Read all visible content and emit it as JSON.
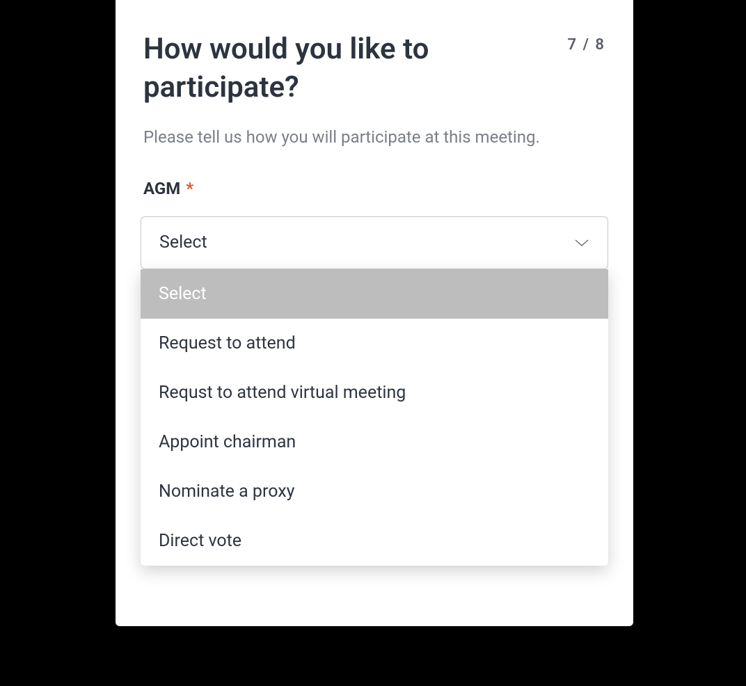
{
  "header": {
    "title": "How would you like to participate?",
    "step_counter": "7 / 8"
  },
  "subtitle": "Please tell us how you will participate at this meeting.",
  "field": {
    "label": "AGM",
    "required_marker": "*",
    "selected": "Select",
    "options": [
      {
        "label": "Select",
        "highlighted": true
      },
      {
        "label": "Request to attend",
        "highlighted": false
      },
      {
        "label": "Requst to attend virtual meeting",
        "highlighted": false
      },
      {
        "label": "Appoint chairman",
        "highlighted": false
      },
      {
        "label": "Nominate a proxy",
        "highlighted": false
      },
      {
        "label": "Direct vote",
        "highlighted": false
      }
    ]
  }
}
